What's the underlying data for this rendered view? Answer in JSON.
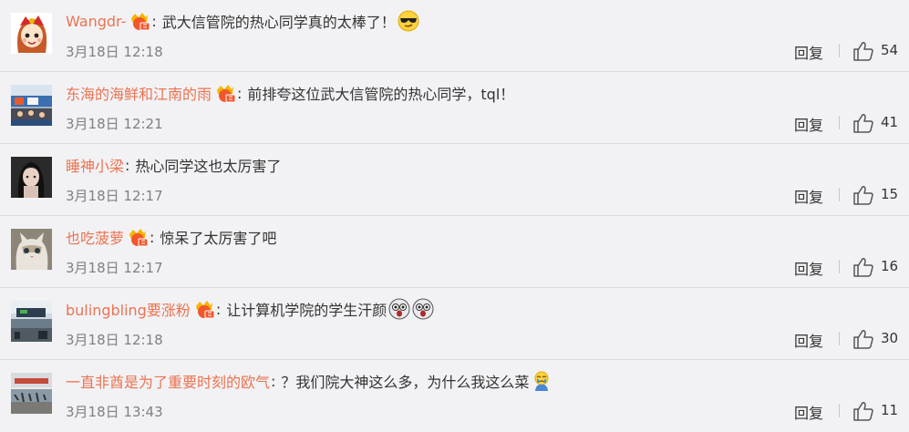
{
  "comments": [
    {
      "username": "Wangdr-",
      "has_vip": true,
      "text": "武大信管院的热心同学真的太棒了！",
      "emoji": "sunglasses-emoji",
      "time": "3月18日 12:18",
      "reply_label": "回复",
      "likes": "54"
    },
    {
      "username": "东海的海鲜和江南的雨",
      "has_vip": true,
      "text": "前排夸这位武大信管院的热心同学，tql！",
      "emoji": "",
      "time": "3月18日 12:21",
      "reply_label": "回复",
      "likes": "41"
    },
    {
      "username": "睡神小梁",
      "has_vip": false,
      "text": "热心同学这也太厉害了",
      "emoji": "",
      "time": "3月18日 12:17",
      "reply_label": "回复",
      "likes": "15"
    },
    {
      "username": "也吃菠萝",
      "has_vip": true,
      "text": "惊呆了太厉害了吧",
      "emoji": "",
      "time": "3月18日 12:17",
      "reply_label": "回复",
      "likes": "16"
    },
    {
      "username": "bulingbling要涨粉",
      "has_vip": true,
      "text": "让计算机学院的学生汗颜",
      "emoji": "shocked-emoji-x2",
      "time": "3月18日 12:18",
      "reply_label": "回复",
      "likes": "30"
    },
    {
      "username": "一直非酋是为了重要时刻的欧气",
      "has_vip": false,
      "text": "？我们院大神这么多，为什么我这么菜",
      "emoji": "crying-emoji",
      "time": "3月18日 13:43",
      "reply_label": "回复",
      "likes": "11"
    }
  ],
  "colors": {
    "username": "#eb7350",
    "time": "#808080",
    "background": "#f2f2f5",
    "divider": "#dcdcdc"
  }
}
